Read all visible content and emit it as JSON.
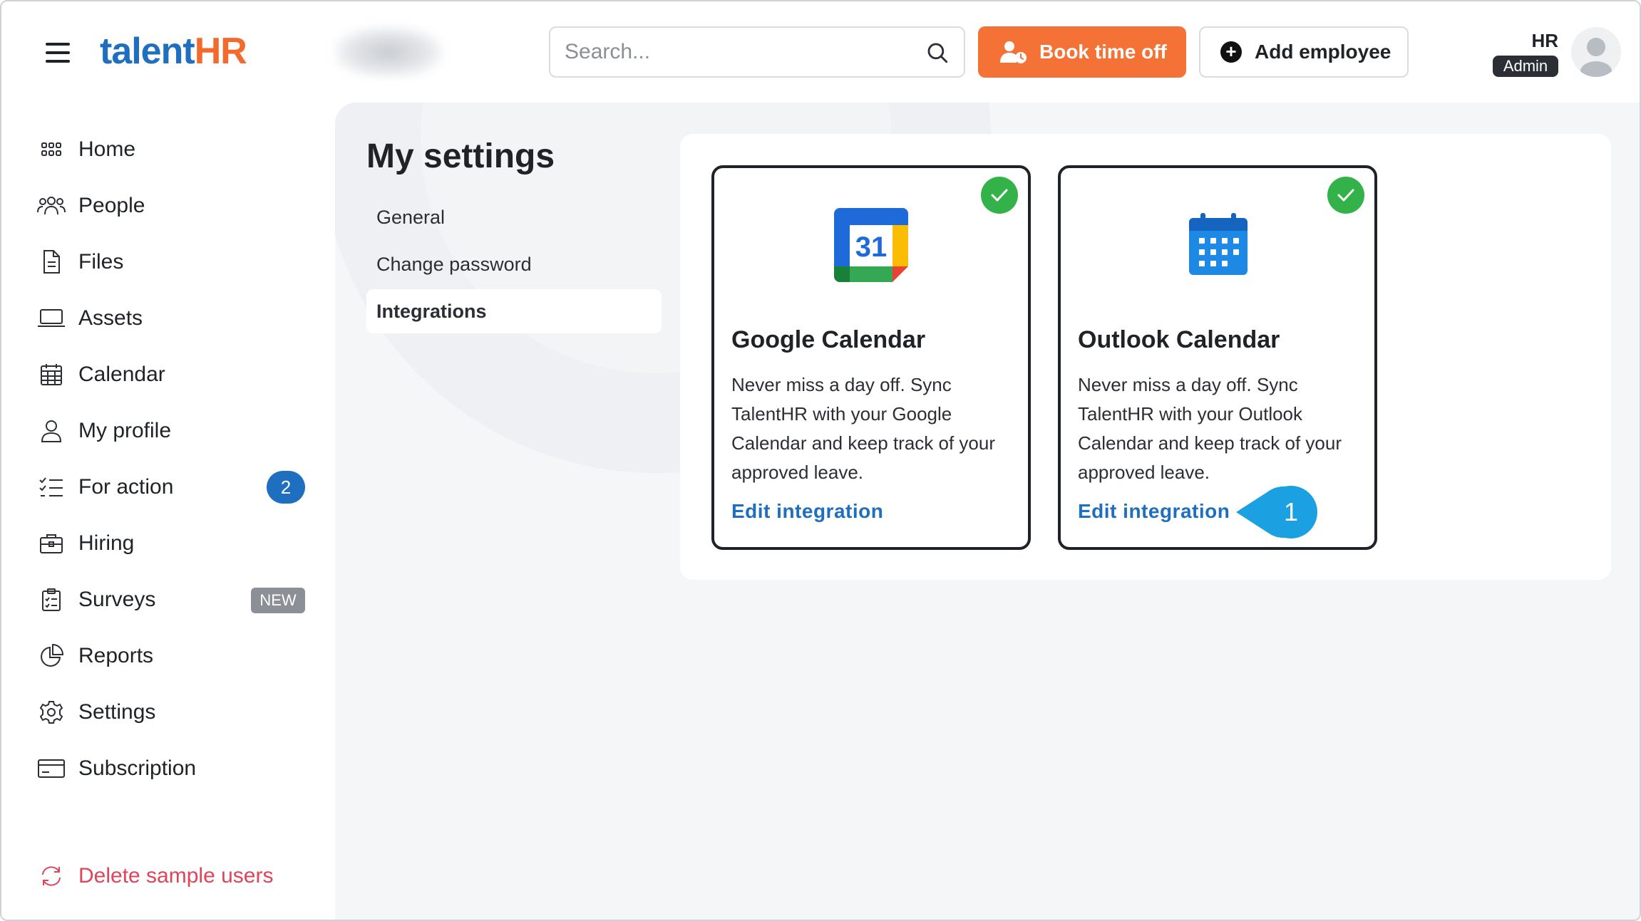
{
  "app": {
    "logo_part1": "talent",
    "logo_part2": "HR"
  },
  "header": {
    "search_placeholder": "Search...",
    "book_time_off_label": "Book time off",
    "add_employee_label": "Add employee",
    "user_initials": "HR",
    "user_role": "Admin"
  },
  "sidebar": {
    "items": [
      {
        "label": "Home",
        "icon": "grid-icon"
      },
      {
        "label": "People",
        "icon": "people-icon"
      },
      {
        "label": "Files",
        "icon": "file-icon"
      },
      {
        "label": "Assets",
        "icon": "laptop-icon"
      },
      {
        "label": "Calendar",
        "icon": "calendar-icon"
      },
      {
        "label": "My profile",
        "icon": "user-icon"
      },
      {
        "label": "For action",
        "icon": "checklist-icon",
        "badge": "2"
      },
      {
        "label": "Hiring",
        "icon": "briefcase-icon"
      },
      {
        "label": "Surveys",
        "icon": "clipboard-icon",
        "badge": "NEW"
      },
      {
        "label": "Reports",
        "icon": "pie-chart-icon"
      },
      {
        "label": "Settings",
        "icon": "gear-icon"
      },
      {
        "label": "Subscription",
        "icon": "credit-card-icon"
      }
    ],
    "delete_sample_users_label": "Delete sample users"
  },
  "settings": {
    "title": "My settings",
    "nav": [
      {
        "label": "General"
      },
      {
        "label": "Change password"
      },
      {
        "label": "Integrations",
        "active": true
      }
    ]
  },
  "integrations": [
    {
      "title": "Google Calendar",
      "description": "Never miss a day off. Sync TalentHR with your Google Calendar and keep track of your approved leave.",
      "link_label": "Edit integration",
      "logo_text": "31",
      "connected": true
    },
    {
      "title": "Outlook Calendar",
      "description": "Never miss a day off. Sync TalentHR with your Outlook Calendar and keep track of your approved leave.",
      "link_label": "Edit integration",
      "connected": true
    }
  ],
  "callout": {
    "number": "1"
  },
  "colors": {
    "brand_blue": "#1f6fc1",
    "brand_orange": "#f47236",
    "success_green": "#34b24a",
    "danger_red": "#e0445a",
    "callout_blue": "#1ba1e2"
  }
}
